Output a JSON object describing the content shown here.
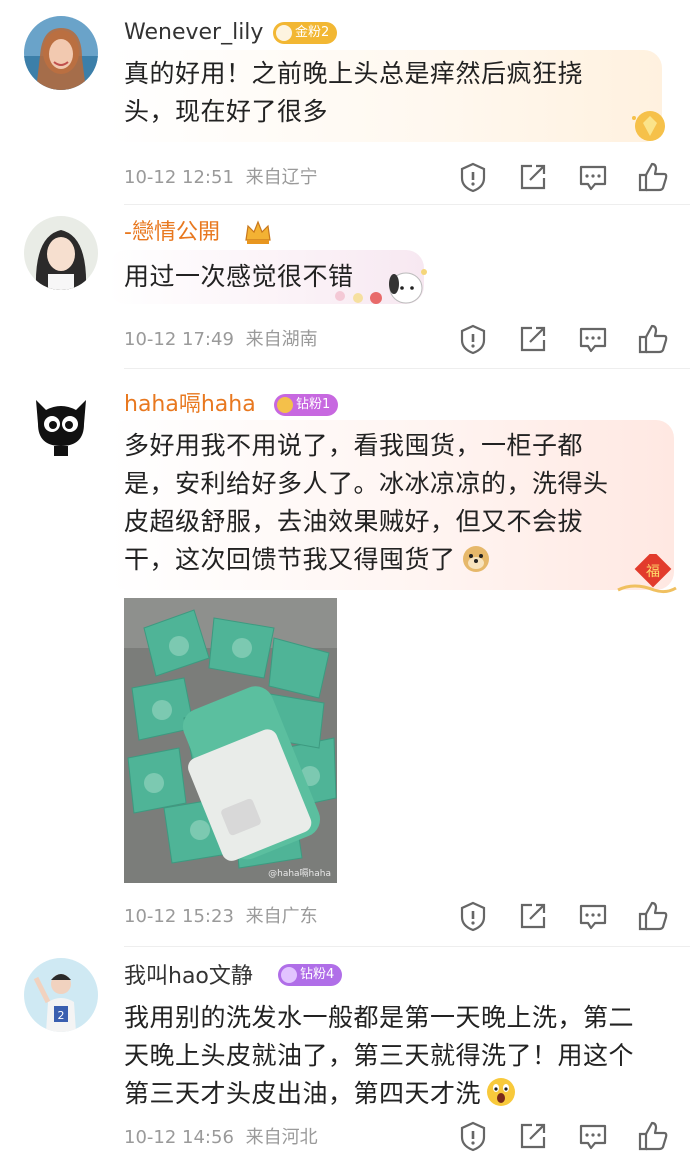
{
  "comments": [
    {
      "username": "Wenever_lily",
      "badge": "金粉2",
      "badge_color": "#f5b62d",
      "text_lines": [
        "真的好用！之前晚上头总是痒然后疯狂挠",
        "头，现在好了很多"
      ],
      "time": "10-12 12:51",
      "location": "来自辽宁"
    },
    {
      "username": "-戀情公開",
      "badge": "",
      "text_lines": [
        "用过一次感觉很不错"
      ],
      "time": "10-12 17:49",
      "location": "来自湖南"
    },
    {
      "username": "haha嗝haha",
      "badge": "钻粉1",
      "badge_color": "#c768e0",
      "text_lines": [
        "多好用我不用说了，看我囤货，一柜子都",
        "是，安利给好多人了。冰冰凉凉的，洗得头",
        "皮超级舒服，去油效果贼好，但又不会拔",
        "干，这次回馈节我又得囤货了"
      ],
      "image_watermark": "@haha嗝haha",
      "time": "10-12 15:23",
      "location": "来自广东"
    },
    {
      "username": "我叫hao文静",
      "badge": "钻粉4",
      "badge_color": "#b06ee8",
      "text_lines": [
        "我用别的洗发水一般都是第一天晚上洗，第二",
        "天晚上头皮就油了，第三天就得洗了！用这个",
        "第三天才头皮出油，第四天才洗"
      ],
      "time": "10-12 14:56",
      "location": "来自河北"
    }
  ],
  "icons": [
    "report-icon",
    "share-icon",
    "reply-icon",
    "like-icon"
  ]
}
